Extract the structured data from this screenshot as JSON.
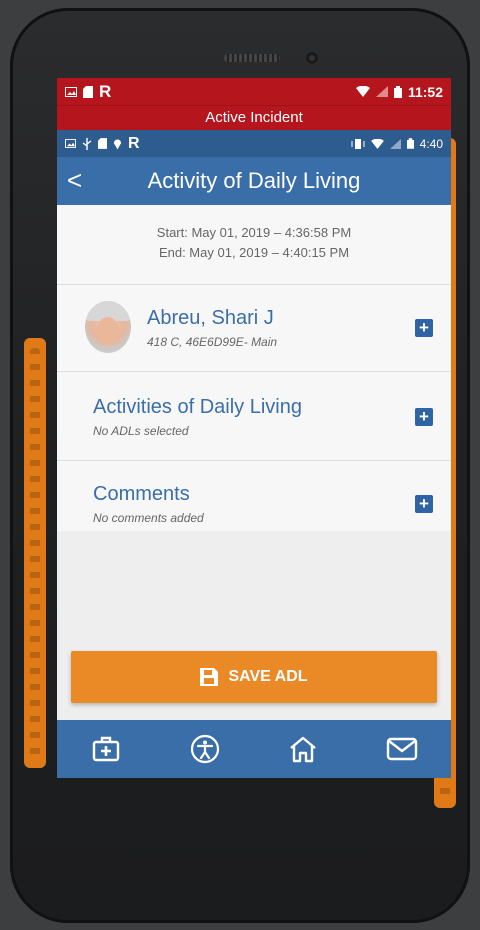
{
  "status_bar_outer": {
    "time": "11:52",
    "app_letter": "R"
  },
  "incident_banner": {
    "text": "Active Incident"
  },
  "status_bar_inner": {
    "time": "4:40",
    "app_letter": "R"
  },
  "header": {
    "back_glyph": "<",
    "title": "Activity of Daily Living"
  },
  "times": {
    "start": "Start: May 01, 2019  –  4:36:58 PM",
    "end": "End: May 01, 2019  –  4:40:15 PM"
  },
  "patient": {
    "name": "Abreu, Shari J",
    "details": "418 C, 46E6D99E- Main",
    "add_icon": "plus-icon"
  },
  "adl_section": {
    "title": "Activities of Daily Living",
    "subtitle": "No ADLs selected"
  },
  "comments_section": {
    "title": "Comments",
    "subtitle": "No comments added"
  },
  "save_button": {
    "label": "SAVE ADL",
    "icon": "floppy-disk-icon"
  },
  "bottom_nav": [
    "medical-kit-icon",
    "accessibility-icon",
    "home-icon",
    "mail-icon"
  ],
  "colors": {
    "header_blue": "#3a6ea8",
    "incident_red": "#b5151d",
    "save_orange": "#e98a26",
    "link_blue": "#3a6ea8"
  }
}
